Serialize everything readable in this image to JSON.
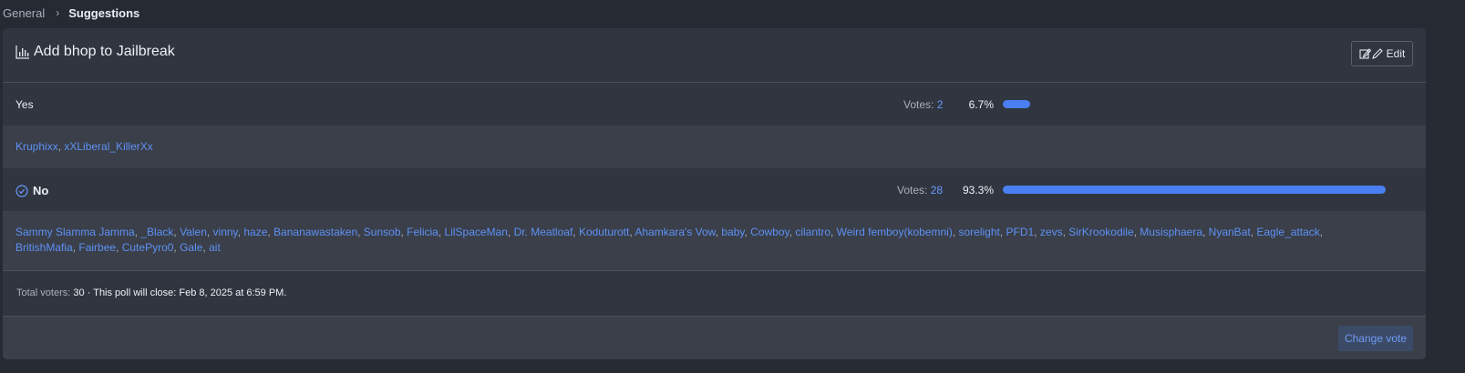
{
  "breadcrumb": {
    "parent": "General",
    "current": "Suggestions"
  },
  "poll": {
    "title": "Add bhop to Jailbreak",
    "edit_label": "Edit",
    "votes_label": "Votes:",
    "answers": [
      {
        "label": "Yes",
        "votes": "2",
        "percent_text": "6.7%",
        "percent": 6.7,
        "voted": false,
        "voters": [
          "Kruphixx",
          "xXLiberal_KillerXx"
        ]
      },
      {
        "label": "No",
        "votes": "28",
        "percent_text": "93.3%",
        "percent": 93.3,
        "voted": true,
        "voters": [
          "Sammy Slamma Jamma",
          "_Black",
          "Valen",
          "vinny",
          "haze",
          "Bananawastaken",
          "Sunsob",
          "Felicia",
          "LilSpaceMan",
          "Dr. Meatloaf",
          "Koduturott",
          "Ahamkara's Vow",
          "baby",
          "Cowboy",
          "cilantro",
          "Weird femboy(kobemni)",
          "sorelight",
          "PFD1",
          "zevs",
          "SirKrookodile",
          "Musisphaera",
          "NyanBat",
          "Eagle_attack",
          "BritishMafia",
          "Fairbee",
          "CutePyro0",
          "Gale",
          "ait"
        ]
      }
    ],
    "total_voters_label": "Total voters:",
    "total_voters": "30",
    "close_text": "This poll will close: Feb 8, 2025 at 6:59 PM.",
    "change_vote_label": "Change vote"
  },
  "colors": {
    "bar": "#4a7ff2",
    "link": "#5e91f5"
  }
}
